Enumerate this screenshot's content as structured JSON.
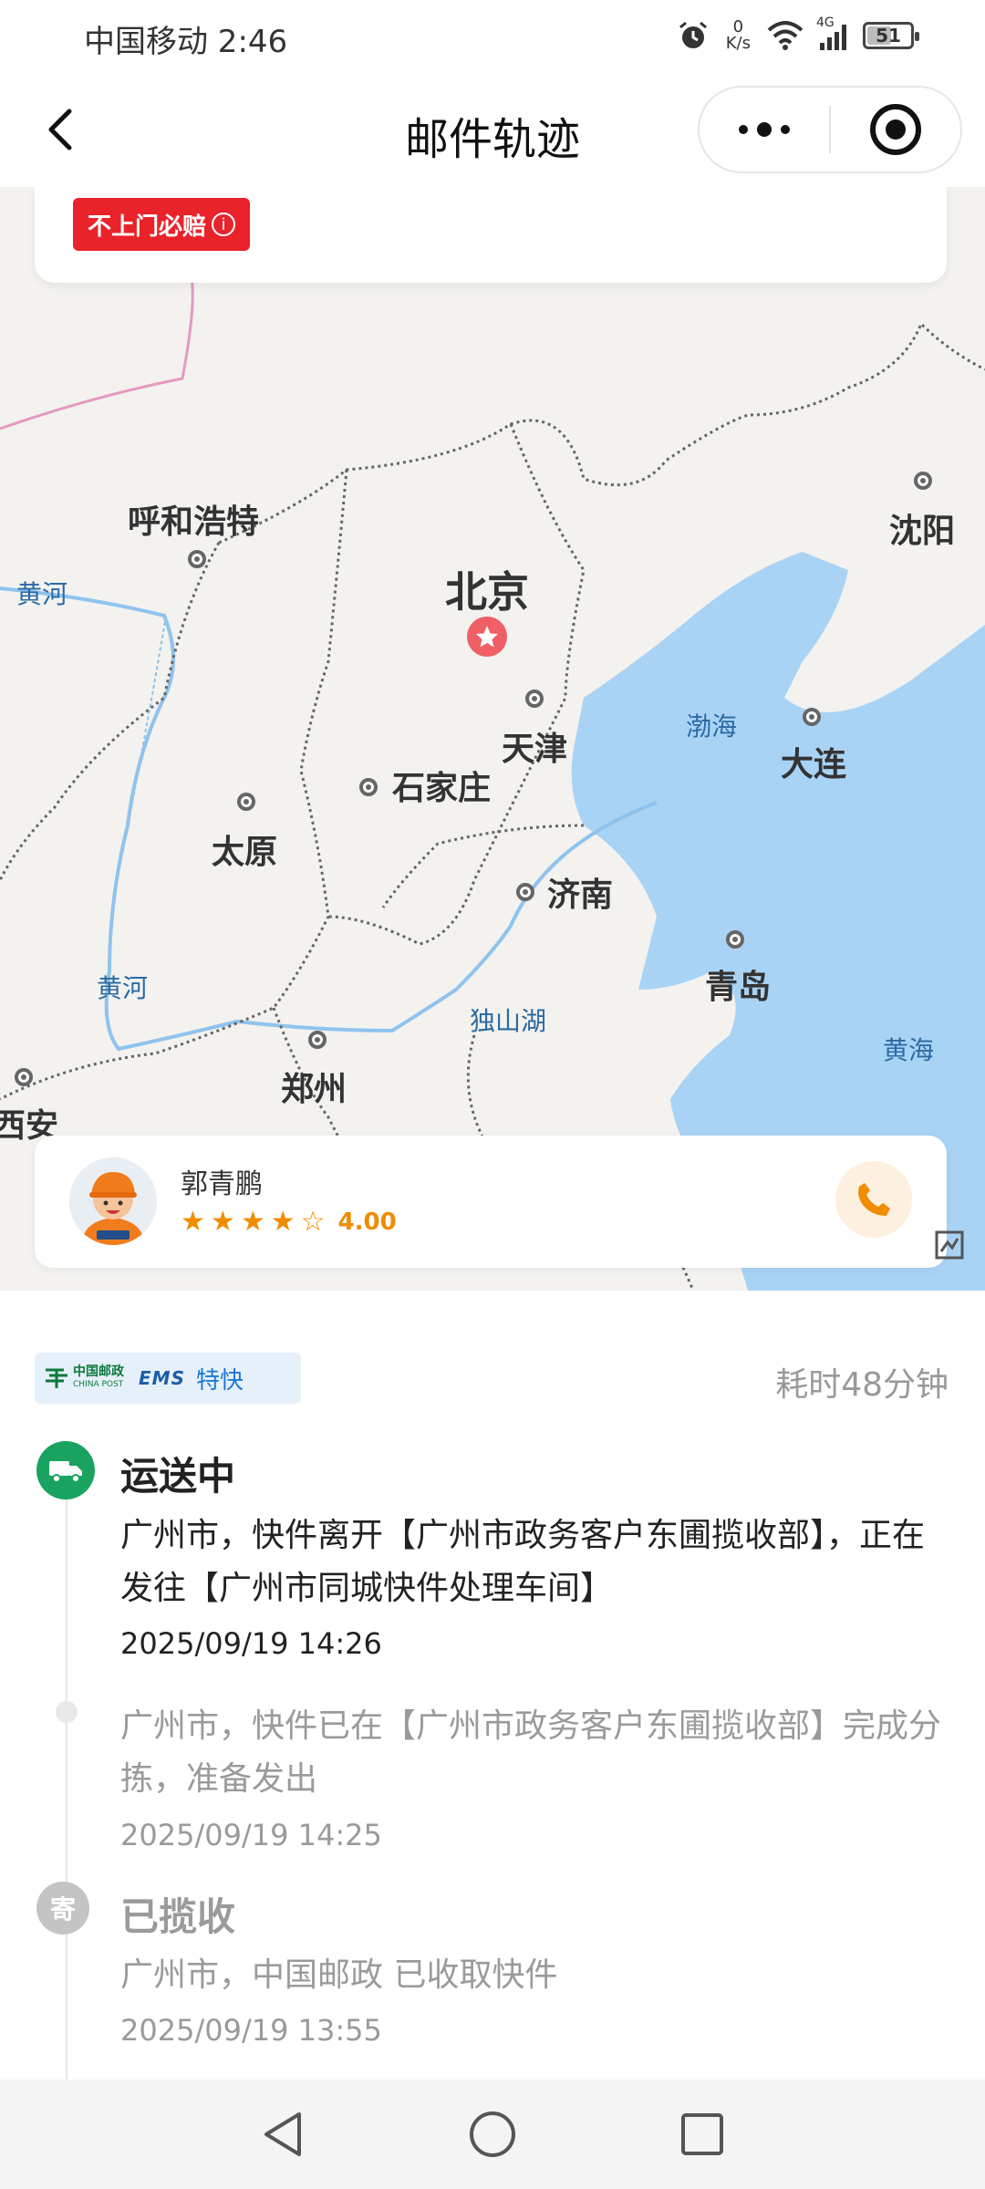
{
  "status_bar": {
    "carrier_time": "中国移动 2:46",
    "net_speed_value": "0",
    "net_speed_unit": "K/s",
    "network": "4G",
    "battery": "51"
  },
  "header": {
    "title": "邮件轨迹"
  },
  "notice": {
    "badge_label": "不上门必赔",
    "badge_color": "#e8232a"
  },
  "map": {
    "cities": {
      "hohhot": "呼和浩特",
      "beijing": "北京",
      "tianjin": "天津",
      "shijiazhuang": "石家庄",
      "taiyuan": "太原",
      "jinan": "济南",
      "qingdao": "青岛",
      "zhengzhou": "郑州",
      "xian": "西安",
      "shenyang": "沈阳",
      "dalian": "大连"
    },
    "water": {
      "yellow_river_1": "黄河",
      "yellow_river_2": "黄河",
      "bohai": "渤海",
      "yellow_sea": "黄海",
      "dushan_lake": "独山湖"
    }
  },
  "courier": {
    "name": "郭青鹏",
    "rating": "4.00",
    "rating_value": 4,
    "rating_max": 5
  },
  "tracking": {
    "brand_cn": "中国邮政",
    "brand_en": "CHINA POST",
    "brand_ems": "EMS",
    "brand_service": "特快",
    "duration": "耗时48分钟",
    "events": [
      {
        "status": "运送中",
        "desc": "广州市，快件离开【广州市政务客户东圃揽收部】，正在发往【广州市同城快件处理车间】",
        "time": "2025/09/19 14:26"
      },
      {
        "desc": "广州市，快件已在【广州市政务客户东圃揽收部】完成分拣，准备发出",
        "time": "2025/09/19 14:25"
      },
      {
        "status": "已揽收",
        "node_label": "寄",
        "desc": "广州市，中国邮政 已收取快件",
        "time": "2025/09/19 13:55"
      }
    ]
  },
  "colors": {
    "accent_green": "#1aa260",
    "rating_orange": "#f08c00",
    "water_blue": "#a9d3f5"
  }
}
